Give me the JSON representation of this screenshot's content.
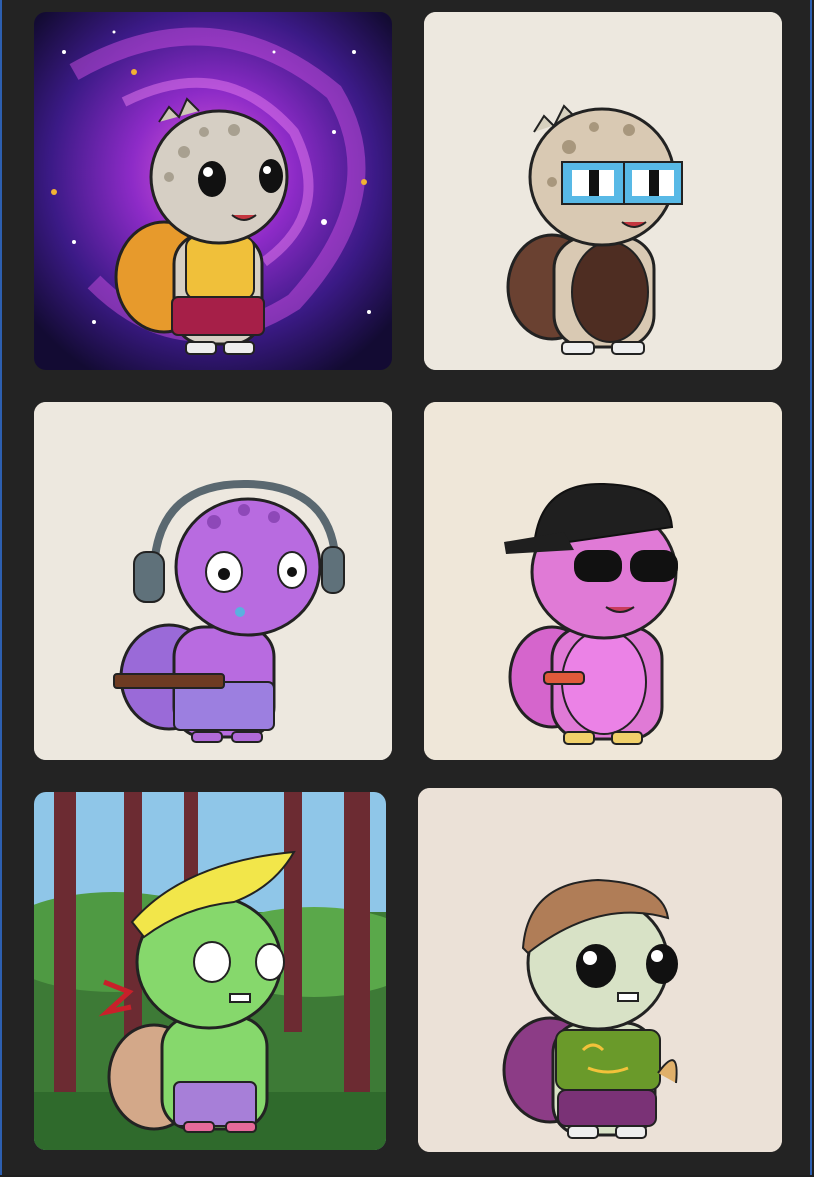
{
  "gallery": {
    "items": [
      {
        "background": "galaxy",
        "skin": "#d6cfc4",
        "shell": "#e79a2c",
        "accessory": "eyelashes"
      },
      {
        "background": "plain",
        "bg_color": "#ede8df",
        "skin": "#d9c9b3",
        "shell": "#6a4131",
        "accessory": "pixel-glasses"
      },
      {
        "background": "plain",
        "bg_color": "#ede8df",
        "skin": "#b86be0",
        "shell": "#9a6ad8",
        "accessory": "headphones"
      },
      {
        "background": "plain",
        "bg_color": "#efe7d9",
        "skin": "#e07ad6",
        "shell": "#d565cc",
        "accessory": "cap-sunglasses"
      },
      {
        "background": "forest",
        "skin": "#86d86c",
        "shell": "#d3a889",
        "accessory": "yellow-hair"
      },
      {
        "background": "plain",
        "bg_color": "#ebe1d7",
        "skin": "#d8e2c6",
        "shell": "#8c3c86",
        "accessory": "helmet-shirt"
      }
    ]
  },
  "colors": {
    "page_bg": "#232323",
    "frame_border": "#2d5fb0"
  }
}
